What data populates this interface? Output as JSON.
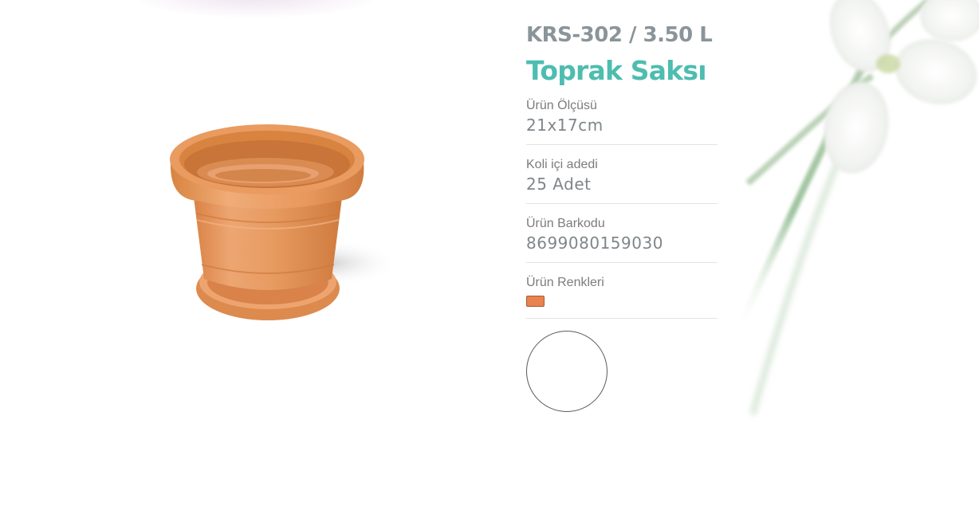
{
  "product": {
    "code": "KRS-302 / 3.50 L",
    "title": "Toprak Saksı",
    "image_name": "terracotta-flower-pot"
  },
  "specs": [
    {
      "label": "Ürün Ölçüsü",
      "value": "21x17cm"
    },
    {
      "label": "Koli içi adedi",
      "value": "25 Adet"
    },
    {
      "label": "Ürün Barkodu",
      "value": "8699080159030"
    }
  ],
  "colors": {
    "label": "Ürün Renkleri",
    "swatches": [
      "#e8834f"
    ]
  },
  "theme": {
    "title_color": "#4dbdb0",
    "code_color": "#8a9499"
  }
}
